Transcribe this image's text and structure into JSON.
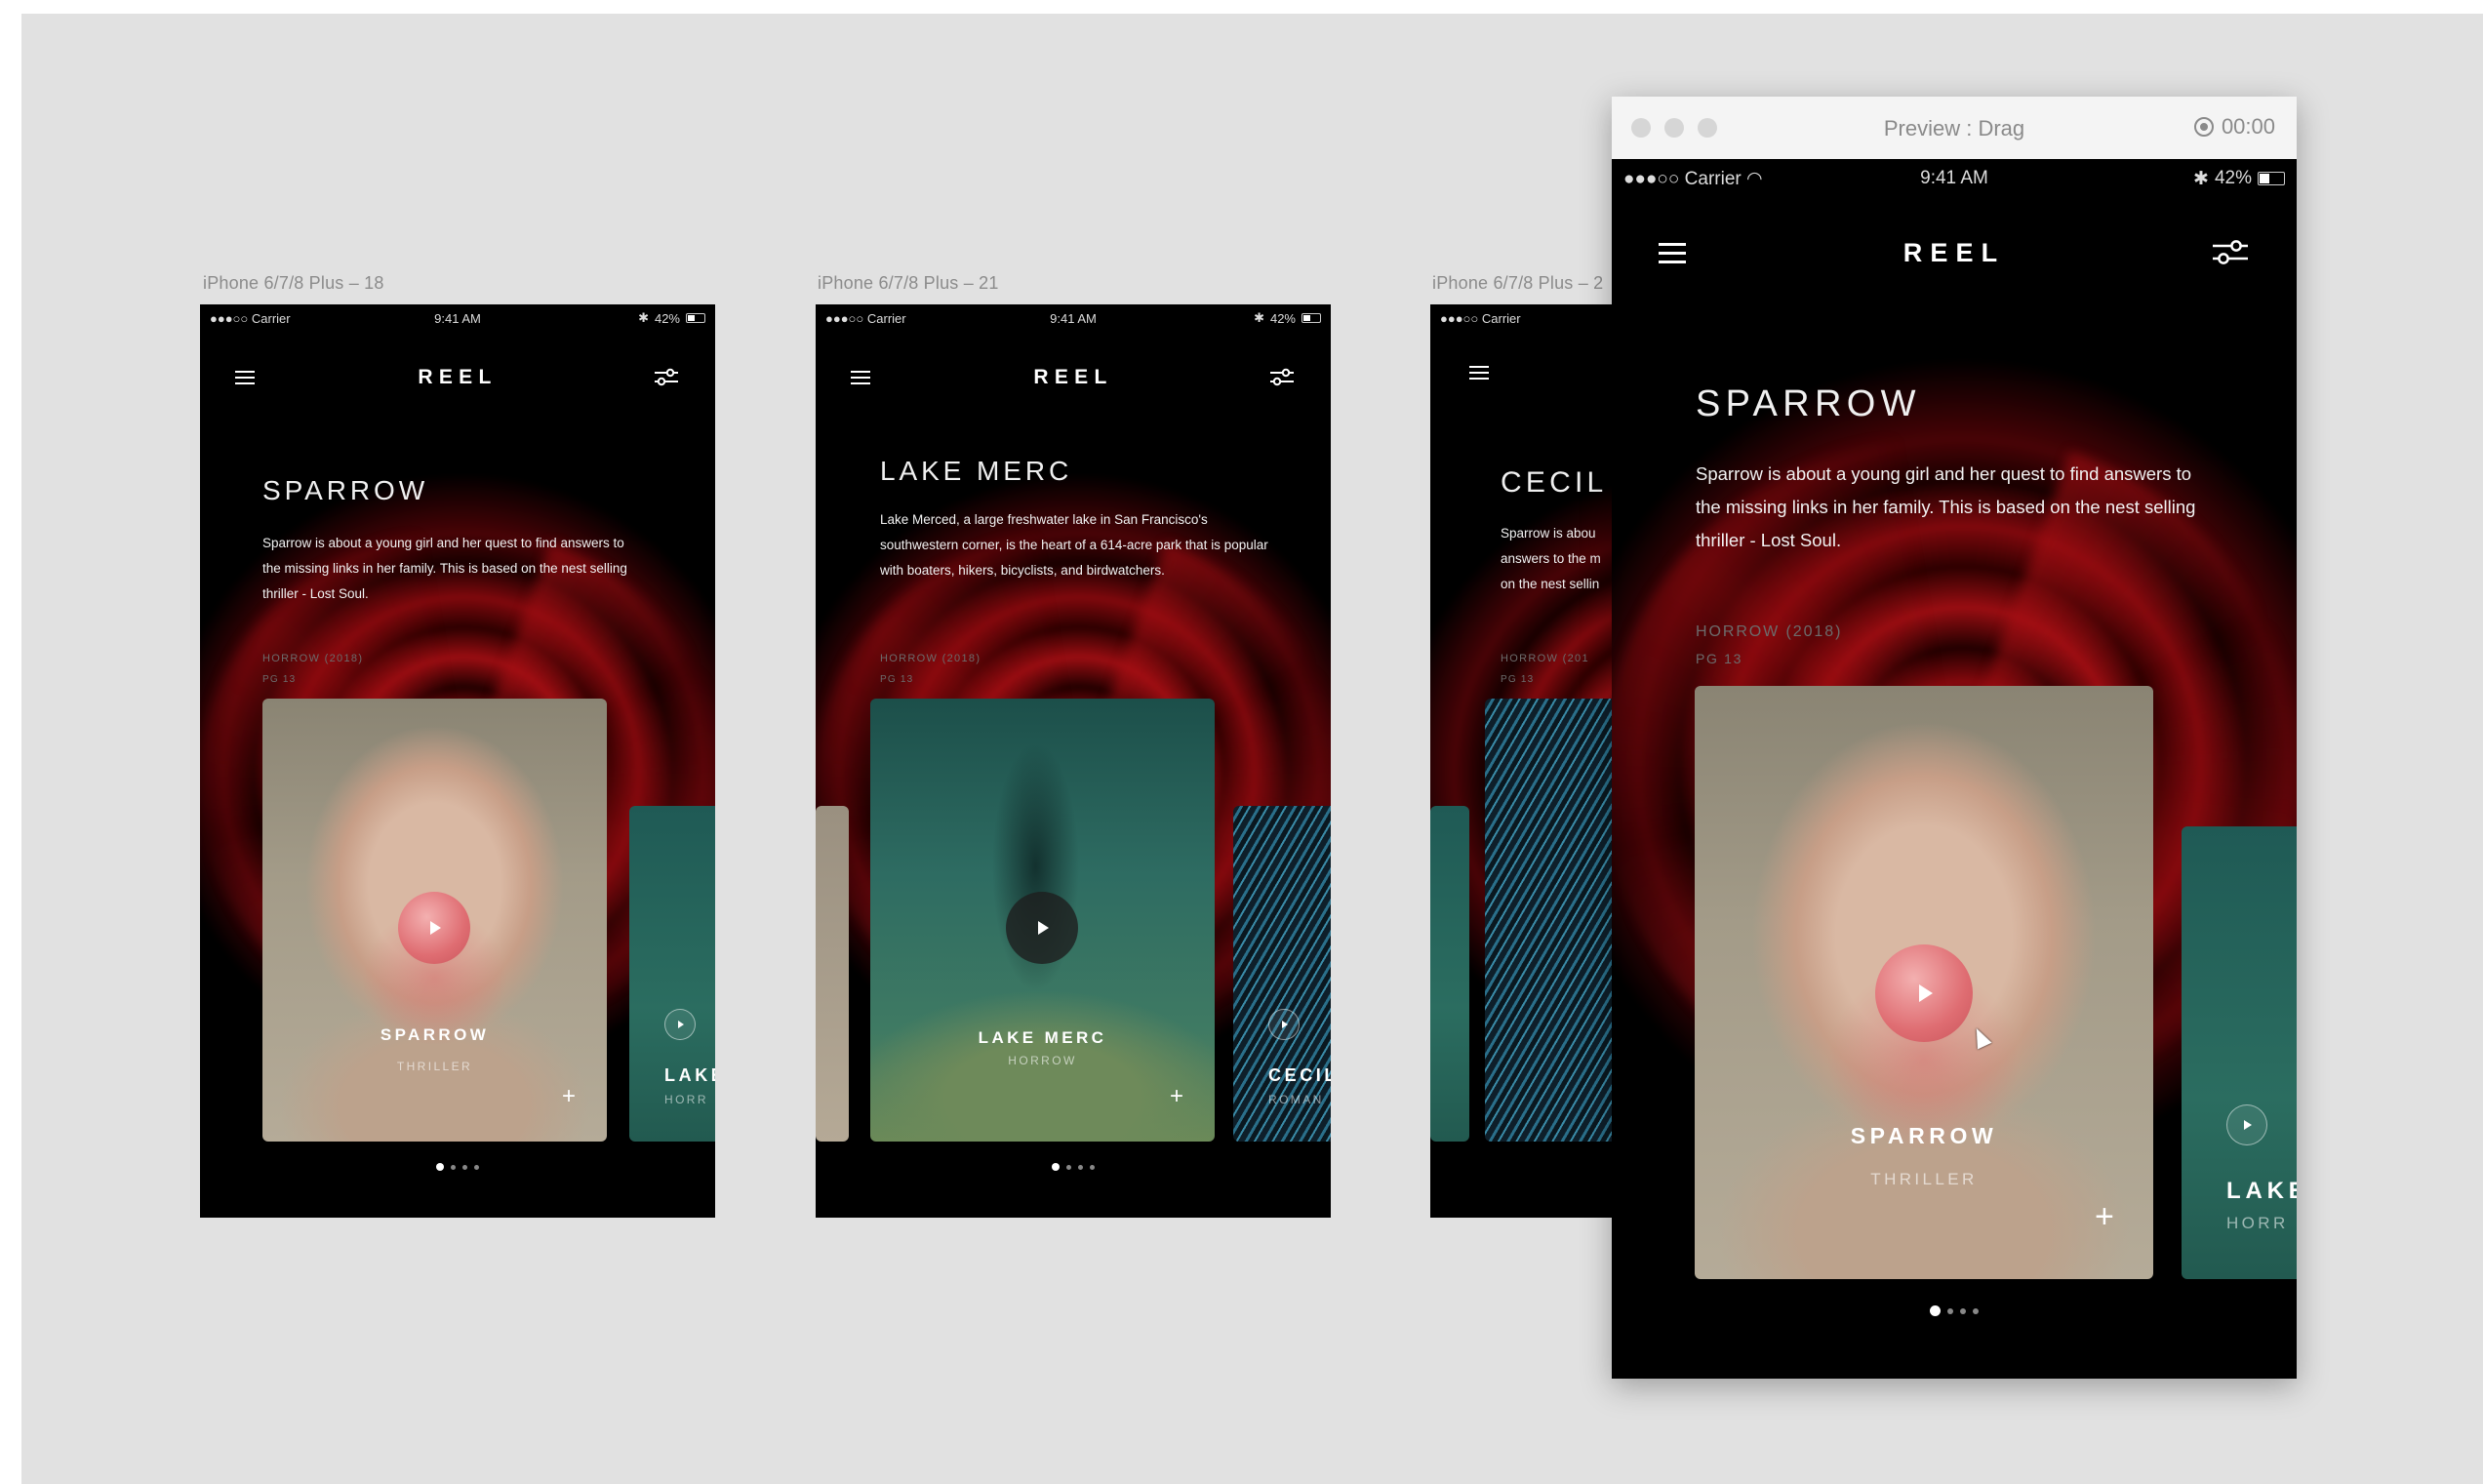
{
  "artboards": [
    {
      "label": "iPhone 6/7/8 Plus – 18",
      "status": {
        "carrier": "●●●○○ Carrier",
        "time": "9:41 AM",
        "battery": "42%"
      },
      "brand": "REEL",
      "title": "SPARROW",
      "description": "Sparrow is about a young girl and her quest to find answers to the missing links in her family. This is based on the nest selling thriller - Lost Soul.",
      "meta_line1": "HORROW (2018)",
      "meta_line2": "PG 13",
      "card": {
        "title": "SPARROW",
        "genre": "THRILLER",
        "plus": "+"
      },
      "peek": {
        "title": "LAKE",
        "sub": "HORR"
      }
    },
    {
      "label": "iPhone 6/7/8 Plus – 21",
      "status": {
        "carrier": "●●●○○ Carrier",
        "time": "9:41 AM",
        "battery": "42%"
      },
      "brand": "REEL",
      "title": "LAKE MERC",
      "description": "Lake Merced, a large freshwater lake in San Francisco's southwestern corner, is the heart of a 614-acre park that is popular with boaters, hikers, bicyclists, and birdwatchers.",
      "meta_line1": "HORROW (2018)",
      "meta_line2": "PG 13",
      "card": {
        "title": "LAKE MERC",
        "genre": "HORROW",
        "plus": "+"
      },
      "peek": {
        "title": "CECIL",
        "sub": "ROMAN"
      }
    },
    {
      "label": "iPhone 6/7/8 Plus – 2",
      "status": {
        "carrier": "●●●○○ Carrier"
      },
      "title": "CECIL",
      "description": "Sparrow is abou answers to the m on the nest sellin",
      "meta_line1": "HORROW (201",
      "meta_line2": "PG 13"
    }
  ],
  "preview": {
    "window_title": "Preview : Drag",
    "timer": "00:00",
    "status": {
      "carrier": "●●●○○ Carrier",
      "time": "9:41 AM",
      "battery": "42%"
    },
    "brand": "REEL",
    "title": "SPARROW",
    "description": "Sparrow is about a young girl and her quest to find answers to the missing links in her family. This is based on the nest selling thriller - Lost Soul.",
    "meta_line1": "HORROW (2018)",
    "meta_line2": "PG 13",
    "card": {
      "title": "SPARROW",
      "genre": "THRILLER",
      "plus": "+"
    },
    "peek": {
      "title": "LAKE",
      "sub": "HORR"
    }
  },
  "icons": {
    "menu": "hamburger-menu-icon",
    "filter": "sliders-filter-icon",
    "play": "play-icon",
    "add": "plus-icon",
    "wifi": "wifi-icon",
    "bluetooth": "bluetooth-icon",
    "battery": "battery-icon",
    "record": "record-icon"
  },
  "colors": {
    "background": "#e1e1e1",
    "phone_bg": "#000000",
    "accent_red": "#b01218",
    "play_pink": "#df6d72"
  }
}
